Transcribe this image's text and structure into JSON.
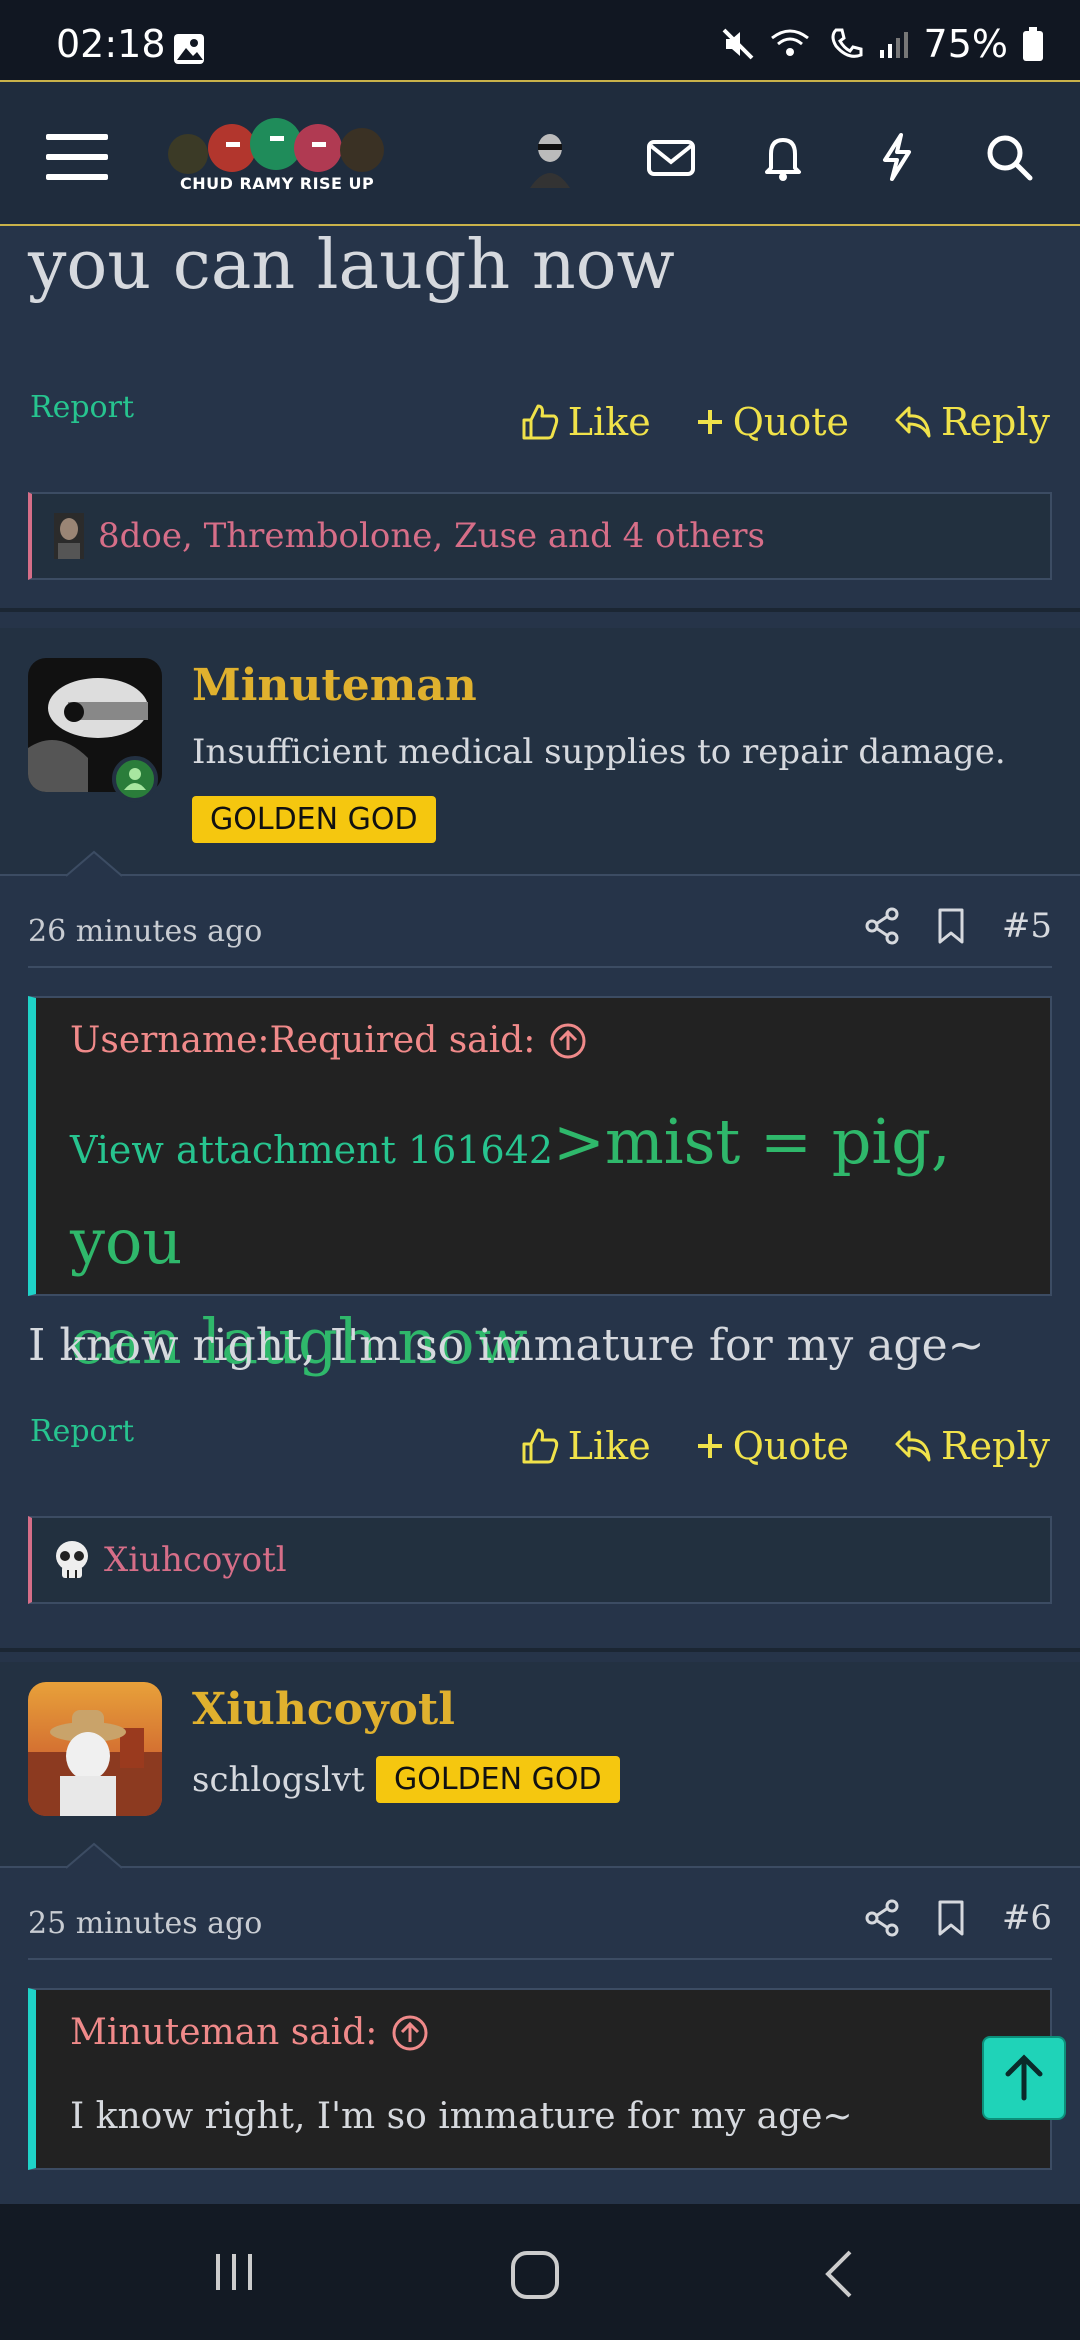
{
  "status": {
    "time": "02:18",
    "battery": "75%"
  },
  "header": {
    "logo_text": "CHUD RAMY RISE UP"
  },
  "post4": {
    "tail_text": "you can laugh now",
    "report": "Report",
    "like": "Like",
    "quote": "Quote",
    "reply": "Reply",
    "reactions": "8doe, Thrembolone, Zuse and 4 others"
  },
  "post5": {
    "username": "Minuteman",
    "user_title": "Insufficient medical supplies to repair damage.",
    "badge": "GOLDEN GOD",
    "time": "26 minutes ago",
    "number": "#5",
    "quote_author": "Username:Required said:",
    "attachment": "View attachment 161642",
    "quote_green_1": ">mist = pig, you",
    "quote_green_2": "can laugh now",
    "body": "I know right, I'm so immature for my age~",
    "report": "Report",
    "like": "Like",
    "quote": "Quote",
    "reply": "Reply",
    "reactions": "Xiuhcoyotl"
  },
  "post6": {
    "username": "Xiuhcoyotl",
    "user_title": "schlogslvt",
    "badge": "GOLDEN GOD",
    "time": "25 minutes ago",
    "number": "#6",
    "quote_author": "Minuteman said:",
    "quote_body": "I know right, I'm so immature for my age~"
  },
  "icons": {
    "colors": {
      "accent_yellow": "#f0e24a",
      "report_green": "#27c48f",
      "reaction_pink": "#d66e88",
      "badge_gold": "#f5c70f",
      "quote_border": "#1fd3c8"
    }
  }
}
